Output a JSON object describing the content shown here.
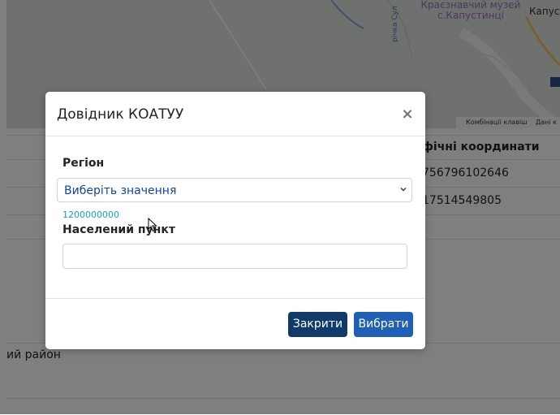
{
  "map": {
    "label_museum": "Краєзнавчий музей\nс.Капустинці",
    "label_kapus": "Капус",
    "label_river": "річка Сул",
    "footer_shortcuts": "Комбінації клавіш",
    "footer_data": "Дані к"
  },
  "background": {
    "column_header": "фічні координати",
    "row1": "756796102646",
    "row2": "17514549805",
    "district_text": "ий район"
  },
  "modal": {
    "title": "Довідник КОАТУУ",
    "close_symbol": "×",
    "region_label": "Регіон",
    "region_select_value": "Виберіть значення",
    "region_code": "1200000000",
    "settlement_label": "Населений пункт",
    "settlement_value": "",
    "btn_close": "Закрити",
    "btn_select": "Вибрати"
  }
}
